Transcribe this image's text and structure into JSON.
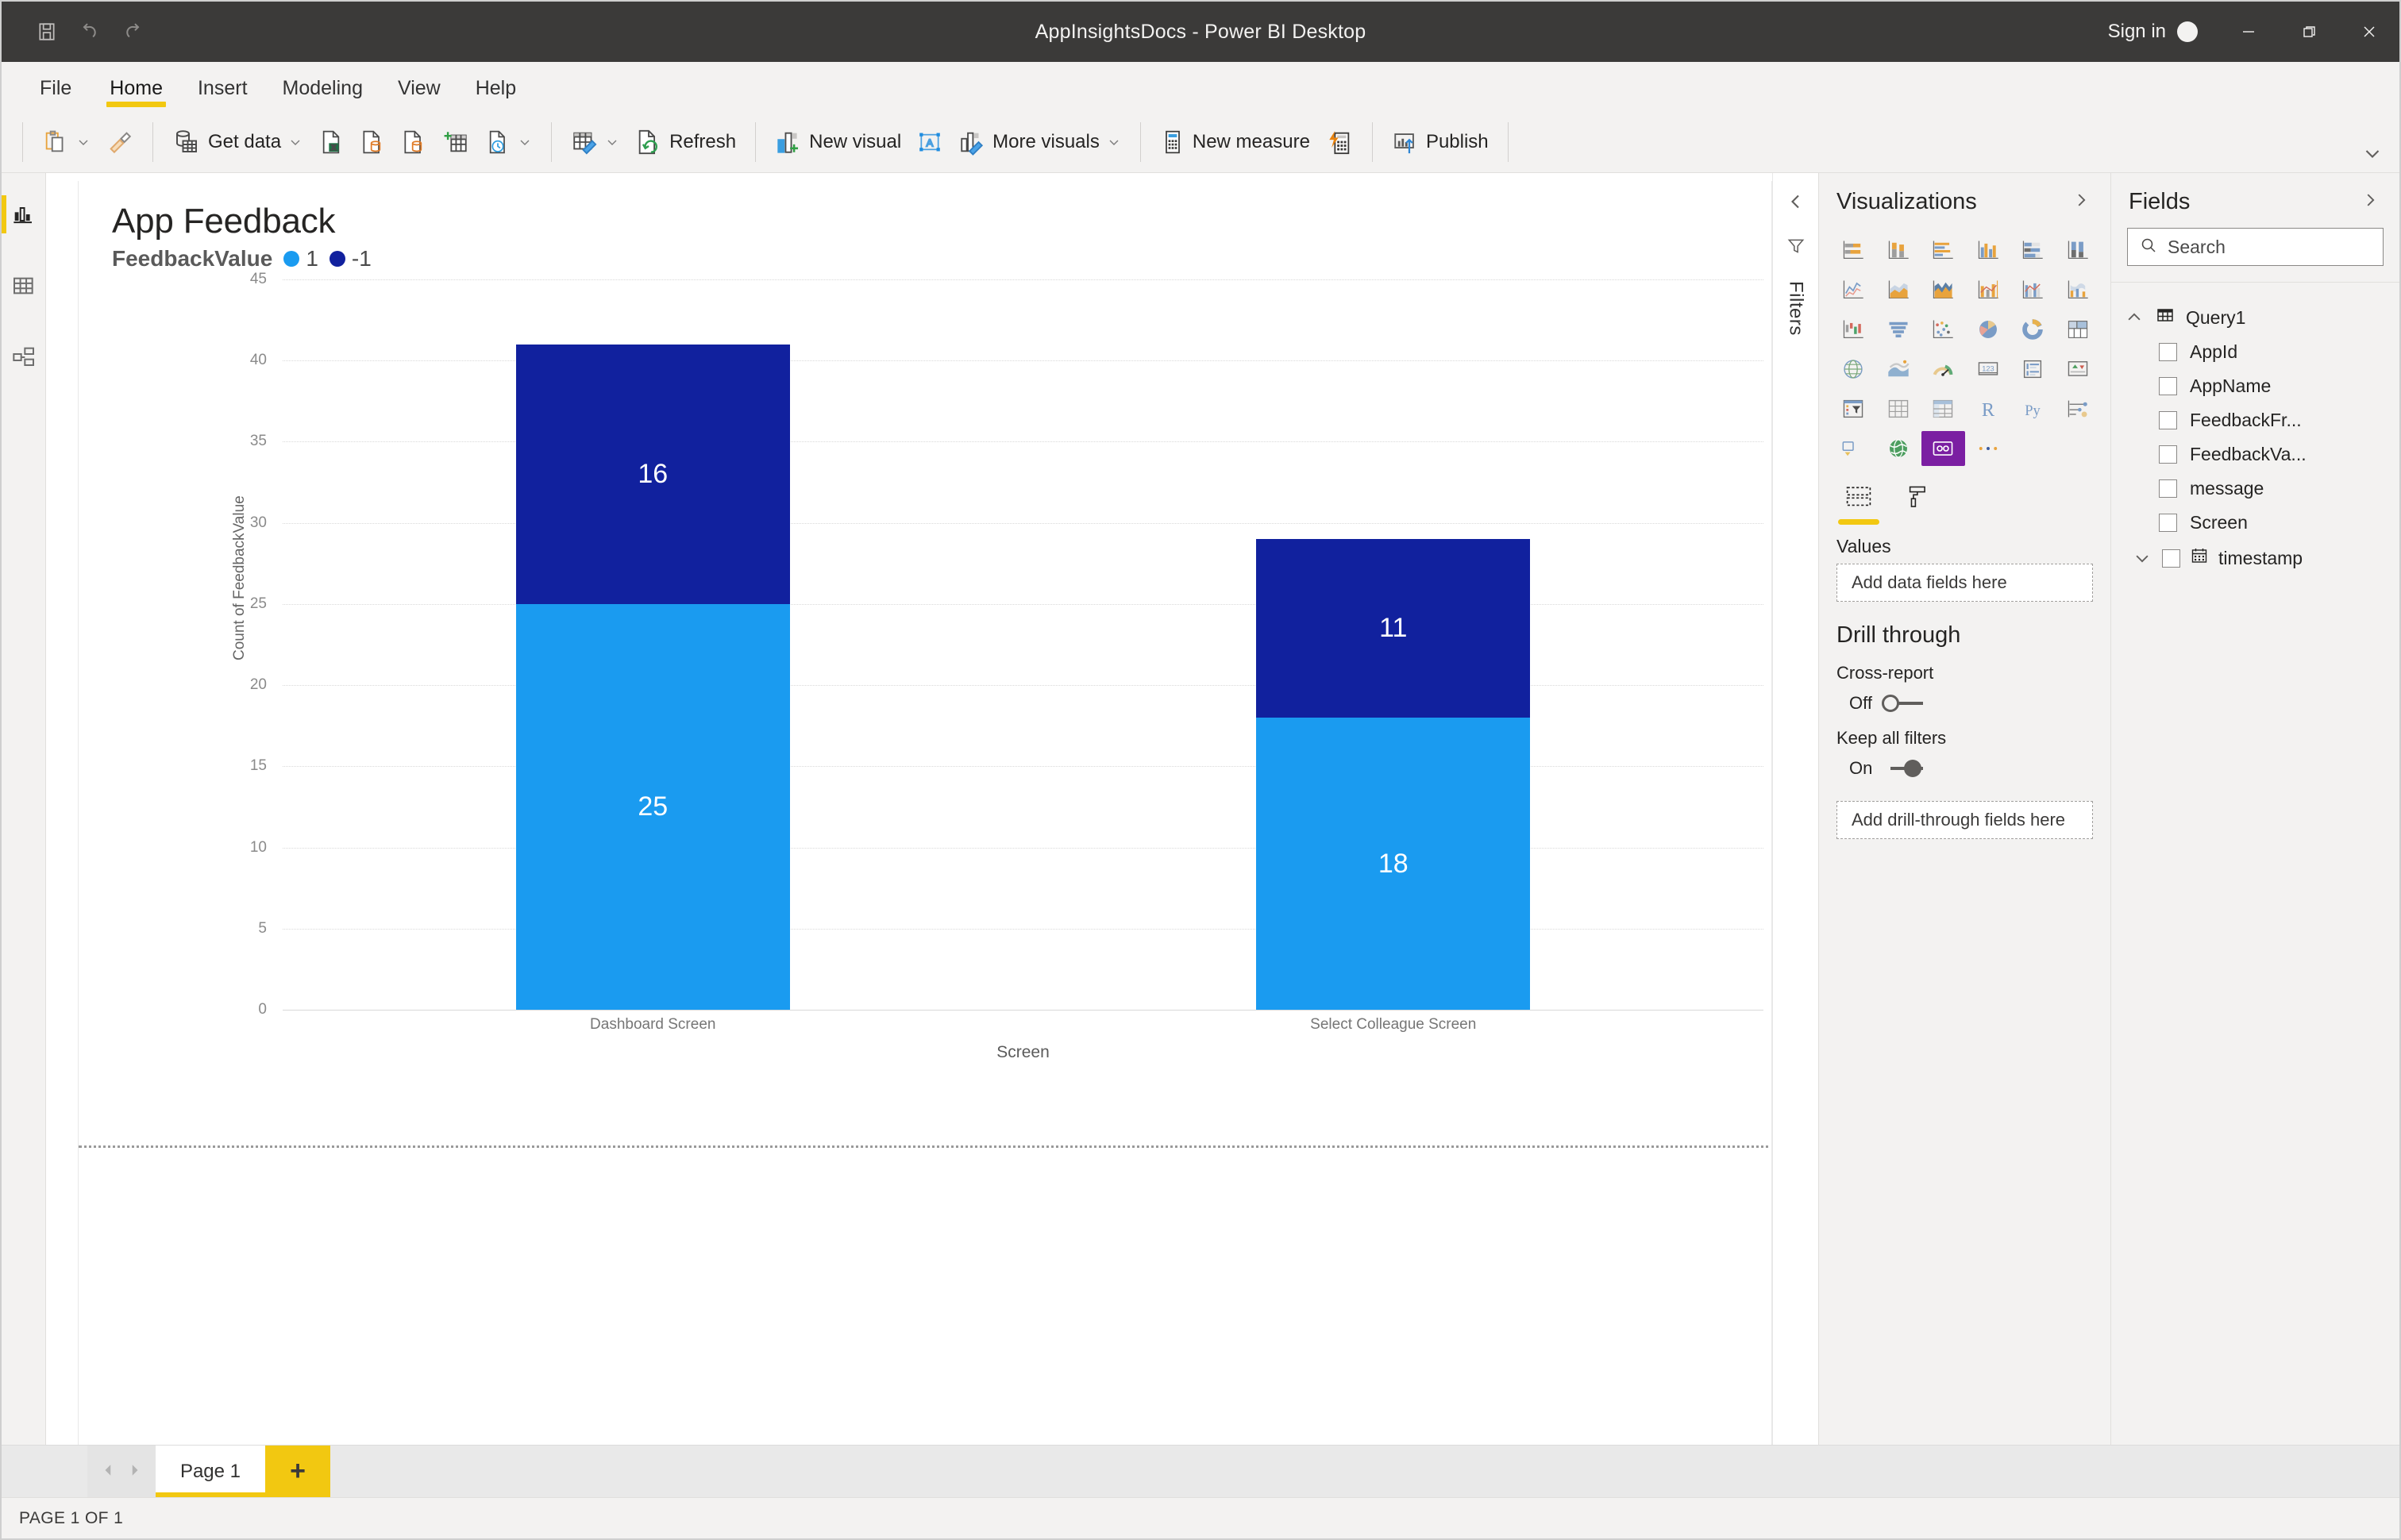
{
  "window": {
    "title": "AppInsightsDocs - Power BI Desktop",
    "sign_in": "Sign in",
    "quick_access": [
      {
        "name": "save-icon",
        "tooltip": "Save"
      },
      {
        "name": "undo-icon",
        "tooltip": "Undo"
      },
      {
        "name": "redo-icon",
        "tooltip": "Redo"
      }
    ],
    "controls": [
      {
        "name": "minimize-button",
        "glyph": "minimize"
      },
      {
        "name": "restore-button",
        "glyph": "restore"
      },
      {
        "name": "close-button",
        "glyph": "close"
      }
    ]
  },
  "menubar": {
    "tabs": [
      {
        "label": "File",
        "active": false
      },
      {
        "label": "Home",
        "active": true
      },
      {
        "label": "Insert",
        "active": false
      },
      {
        "label": "Modeling",
        "active": false
      },
      {
        "label": "View",
        "active": false
      },
      {
        "label": "Help",
        "active": false
      }
    ]
  },
  "ribbon": {
    "items": [
      {
        "label": "",
        "icon": "paste-icon",
        "caret": true
      },
      {
        "label": "",
        "icon": "format-painter-icon",
        "caret": false
      },
      {
        "label": "Get data",
        "icon": "get-data-icon",
        "caret": true
      },
      {
        "label": "",
        "icon": "excel-workbook-icon",
        "caret": false
      },
      {
        "label": "",
        "icon": "sql-server-icon",
        "caret": false
      },
      {
        "label": "",
        "icon": "enter-data-icon",
        "caret": false
      },
      {
        "label": "",
        "icon": "dataverse-icon",
        "caret": false
      },
      {
        "label": "",
        "icon": "recent-sources-icon",
        "caret": true
      },
      {
        "label": "",
        "icon": "transform-data-icon",
        "caret": true
      },
      {
        "label": "Refresh",
        "icon": "refresh-icon",
        "caret": false
      },
      {
        "label": "New visual",
        "icon": "new-visual-icon",
        "caret": false
      },
      {
        "label": "",
        "icon": "text-box-icon",
        "caret": false
      },
      {
        "label": "More visuals",
        "icon": "more-visuals-icon",
        "caret": true
      },
      {
        "label": "New measure",
        "icon": "new-measure-icon",
        "caret": false
      },
      {
        "label": "",
        "icon": "quick-measure-icon",
        "caret": false
      },
      {
        "label": "Publish",
        "icon": "publish-icon",
        "caret": false
      }
    ],
    "collapse_icon": "chevron-down-icon"
  },
  "left_rail": {
    "items": [
      {
        "name": "report-view",
        "icon": "report-bar-chart-icon",
        "active": true
      },
      {
        "name": "data-view",
        "icon": "data-table-icon",
        "active": false
      },
      {
        "name": "model-view",
        "icon": "model-relationships-icon",
        "active": false
      }
    ]
  },
  "filters_strip": {
    "collapse_icon": "chevron-left-icon",
    "filter_icon": "filter-funnel-icon",
    "label": "Filters"
  },
  "chart_data": {
    "type": "bar",
    "stacked": true,
    "title": "App Feedback",
    "legend_title": "FeedbackValue",
    "legend_position": "top",
    "xlabel": "Screen",
    "ylabel": "Count of FeedbackValue",
    "categories": [
      "Dashboard Screen",
      "Select Colleague Screen"
    ],
    "ylim": [
      0,
      45
    ],
    "yticks": [
      0,
      5,
      10,
      15,
      20,
      25,
      30,
      35,
      40,
      45
    ],
    "grid": true,
    "series": [
      {
        "name": "1",
        "color": "#1a9bf0",
        "values": [
          25,
          18
        ]
      },
      {
        "name": "-1",
        "color": "#11219e",
        "values": [
          16,
          11
        ]
      }
    ],
    "totals": [
      41,
      29
    ]
  },
  "visualizations": {
    "title": "Visualizations",
    "expand_icon": "chevron-right-icon",
    "gallery": [
      {
        "name": "stacked-bar-chart-icon",
        "selected": false
      },
      {
        "name": "stacked-column-chart-icon",
        "selected": false
      },
      {
        "name": "clustered-bar-chart-icon",
        "selected": false
      },
      {
        "name": "clustered-column-chart-icon",
        "selected": false
      },
      {
        "name": "hundred-percent-stacked-bar-chart-icon",
        "selected": false
      },
      {
        "name": "hundred-percent-stacked-column-chart-icon",
        "selected": false
      },
      {
        "name": "line-chart-icon",
        "selected": false
      },
      {
        "name": "area-chart-icon",
        "selected": false
      },
      {
        "name": "stacked-area-chart-icon",
        "selected": false
      },
      {
        "name": "line-and-stacked-column-chart-icon",
        "selected": false
      },
      {
        "name": "line-and-clustered-column-chart-icon",
        "selected": false
      },
      {
        "name": "ribbon-chart-icon",
        "selected": false
      },
      {
        "name": "waterfall-chart-icon",
        "selected": false
      },
      {
        "name": "funnel-chart-icon",
        "selected": false
      },
      {
        "name": "scatter-chart-icon",
        "selected": false
      },
      {
        "name": "pie-chart-icon",
        "selected": false
      },
      {
        "name": "donut-chart-icon",
        "selected": false
      },
      {
        "name": "treemap-icon",
        "selected": false
      },
      {
        "name": "map-icon",
        "selected": false
      },
      {
        "name": "filled-map-icon",
        "selected": false
      },
      {
        "name": "gauge-icon",
        "selected": false
      },
      {
        "name": "card-icon",
        "selected": false
      },
      {
        "name": "multi-row-card-icon",
        "selected": false
      },
      {
        "name": "kpi-icon",
        "selected": false
      },
      {
        "name": "slicer-icon",
        "selected": false
      },
      {
        "name": "table-icon",
        "selected": false
      },
      {
        "name": "matrix-icon",
        "selected": false
      },
      {
        "name": "r-script-visual-icon",
        "selected": false
      },
      {
        "name": "python-visual-icon",
        "selected": false
      },
      {
        "name": "key-influencers-icon",
        "selected": false
      },
      {
        "name": "decomposition-tree-icon",
        "selected": false
      },
      {
        "name": "arcgis-map-icon",
        "selected": false
      },
      {
        "name": "power-apps-visual-icon",
        "selected": true
      },
      {
        "name": "more-options-icon",
        "selected": false
      }
    ],
    "subtabs": [
      {
        "name": "fields-tab",
        "icon": "fields-well-icon",
        "active": true
      },
      {
        "name": "format-tab",
        "icon": "paint-roller-icon",
        "active": false
      }
    ],
    "wells": [
      {
        "label": "Values",
        "placeholder": "Add data fields here"
      }
    ],
    "drill_through": {
      "title": "Drill through",
      "cross_report": {
        "label": "Cross-report",
        "state": "Off",
        "on": false
      },
      "keep_all_filters": {
        "label": "Keep all filters",
        "state": "On",
        "on": true
      },
      "placeholder": "Add drill-through fields here"
    }
  },
  "fields": {
    "title": "Fields",
    "expand_icon": "chevron-right-icon",
    "search_placeholder": "Search",
    "search_value": "",
    "search_icon": "search-icon",
    "tables": [
      {
        "name": "Query1",
        "icon": "table-icon",
        "expanded": true,
        "columns": [
          {
            "label": "AppId",
            "checked": false,
            "icon": null
          },
          {
            "label": "AppName",
            "checked": false,
            "icon": null
          },
          {
            "label": "FeedbackFr...",
            "checked": false,
            "icon": null
          },
          {
            "label": "FeedbackVa...",
            "checked": false,
            "icon": null
          },
          {
            "label": "message",
            "checked": false,
            "icon": null
          },
          {
            "label": "Screen",
            "checked": false,
            "icon": null
          },
          {
            "label": "timestamp",
            "checked": false,
            "icon": "calendar-icon",
            "expandable": true
          }
        ]
      }
    ]
  },
  "pagebar": {
    "prev_icon": "chevron-left-icon",
    "next_icon": "chevron-right-icon",
    "tabs": [
      {
        "label": "Page 1",
        "active": true
      }
    ],
    "add_label": "+"
  },
  "statusbar": {
    "text": "PAGE 1 OF 1"
  }
}
